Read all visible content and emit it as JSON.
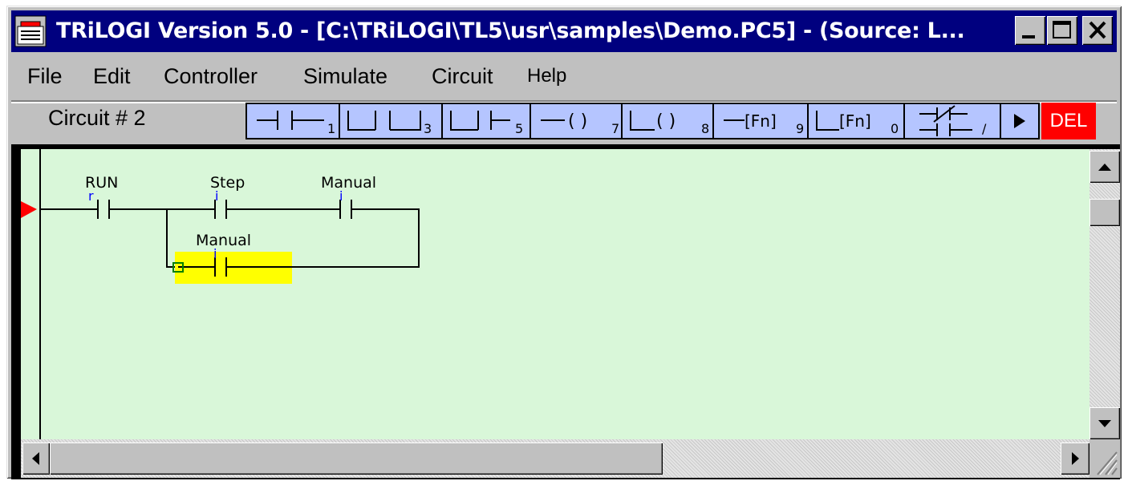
{
  "window": {
    "title": "TRiLOGI Version 5.0 - [C:\\TRiLOGI\\TL5\\usr\\samples\\Demo.PC5] - (Source: L..."
  },
  "menu": [
    "File",
    "Edit",
    "Controller",
    "Simulate",
    "Circuit",
    "Help"
  ],
  "circuit_label": "Circuit # 2",
  "toolbar": {
    "buttons": [
      {
        "icon": "contact-series-icon",
        "key": "1"
      },
      {
        "icon": "contact-parallel-icon",
        "key": "3"
      },
      {
        "icon": "contact-branch-icon",
        "key": "5"
      },
      {
        "icon": "coil-icon",
        "key": "7"
      },
      {
        "icon": "coil-parallel-icon",
        "key": "8"
      },
      {
        "icon": "function-icon",
        "label": "[Fn]",
        "key": "9"
      },
      {
        "icon": "function-parallel-icon",
        "label": "[Fn]",
        "key": "0"
      },
      {
        "icon": "toggle-contact-icon",
        "key": "/"
      },
      {
        "icon": "play-icon"
      }
    ],
    "del_label": "DEL"
  },
  "ladder": {
    "contacts": [
      {
        "name": "RUN",
        "type": "r"
      },
      {
        "name": "Step",
        "type": "i"
      },
      {
        "name": "Manual",
        "type": "i"
      },
      {
        "name": "Manual",
        "type": "i",
        "selected": true
      }
    ]
  },
  "colors": {
    "titlebar": "#00007f",
    "canvas": "#d9f7d9",
    "toolbar_button": "#b5c5ff",
    "del": "#ff0000",
    "selection": "#ffff00",
    "rung_marker": "#ff0000"
  }
}
